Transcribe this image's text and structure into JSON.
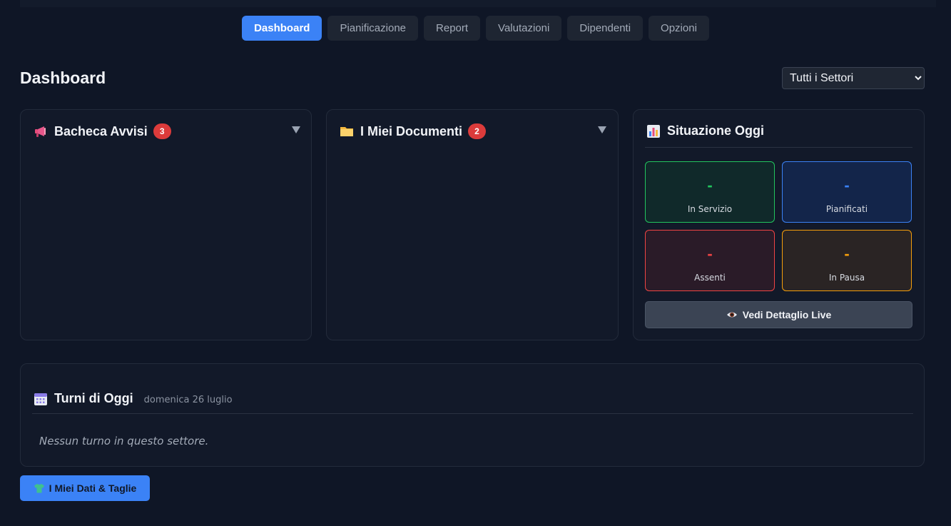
{
  "nav": {
    "tabs": [
      {
        "label": "Dashboard",
        "active": true
      },
      {
        "label": "Pianificazione"
      },
      {
        "label": "Report"
      },
      {
        "label": "Valutazioni"
      },
      {
        "label": "Dipendenti"
      },
      {
        "label": "Opzioni"
      }
    ]
  },
  "header": {
    "title": "Dashboard",
    "sector_select": {
      "value": "Tutti i Settori"
    }
  },
  "announcements": {
    "title": "Bacheca Avvisi",
    "badge": "3",
    "icon": "megaphone-icon"
  },
  "documents": {
    "title": "I Miei Documenti",
    "badge": "2",
    "icon": "folder-icon"
  },
  "today_status": {
    "title": "Situazione Oggi",
    "icon": "bar-chart-icon",
    "stats": [
      {
        "value": "-",
        "label": "In Servizio",
        "color": "#22c55e"
      },
      {
        "value": "-",
        "label": "Pianificati",
        "color": "#3b82f6"
      },
      {
        "value": "-",
        "label": "Assenti",
        "color": "#ef4444"
      },
      {
        "value": "-",
        "label": "In Pausa",
        "color": "#f59e0b"
      }
    ],
    "live_button": {
      "label": "Vedi Dettaglio Live",
      "icon": "eye-icon"
    }
  },
  "shifts": {
    "title": "Turni di Oggi",
    "date": "domenica 26 luglio",
    "empty_message": "Nessun turno in questo settore.",
    "icon": "calendar-icon"
  },
  "my_data_button": {
    "label": "I Miei Dati & Taglie",
    "icon": "tshirt-icon"
  }
}
